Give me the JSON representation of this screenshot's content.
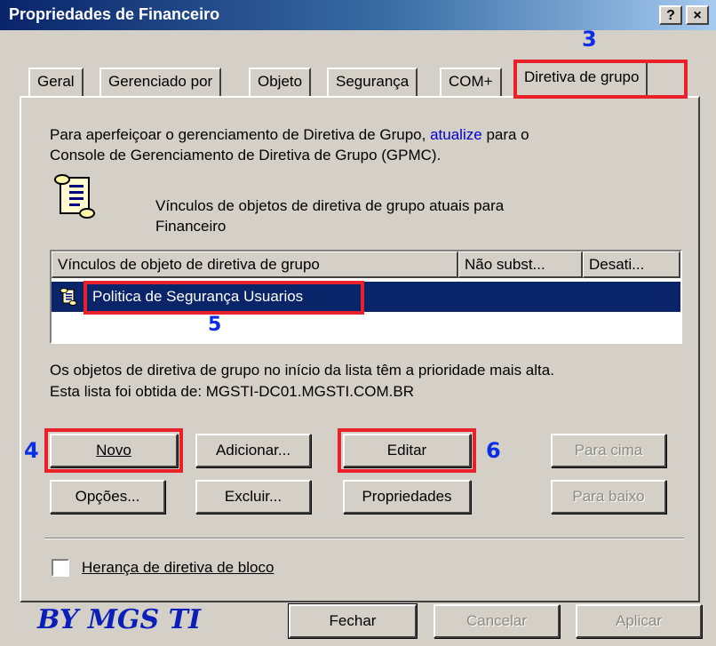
{
  "window": {
    "title": "Propriedades de Financeiro",
    "help_button": "?",
    "close_button": "×"
  },
  "tabs": [
    {
      "label": "Geral"
    },
    {
      "label": "Gerenciado por"
    },
    {
      "label": "Objeto"
    },
    {
      "label": "Segurança"
    },
    {
      "label": "COM+"
    },
    {
      "label": "Diretiva de grupo"
    }
  ],
  "info": {
    "line1_prefix": "Para aperfeiçoar o gerenciamento de Diretiva de Grupo,",
    "link": "atualize",
    "line1_suffix": "para o",
    "line2": "Console de Gerenciamento de Diretiva de Grupo (GPMC)."
  },
  "current_links": {
    "line1": "Vínculos de objetos de diretiva de grupo atuais para",
    "line2": "Financeiro",
    "icon": "scroll-icon"
  },
  "list": {
    "columns": [
      "Vínculos de objeto de diretiva de grupo",
      "Não subst...",
      "Desati..."
    ],
    "rows": [
      {
        "name": "Politica de Segurança Usuarios",
        "icon": "gpo-scroll-icon"
      }
    ]
  },
  "priority_note": {
    "line1": "Os objetos de diretiva de grupo no início da lista têm a prioridade mais alta.",
    "line2": "Esta lista foi obtida de: MGSTI-DC01.MGSTI.COM.BR"
  },
  "buttons": {
    "novo": "Novo",
    "adicionar": "Adicionar...",
    "editar": "Editar",
    "para_cima": "Para cima",
    "opcoes": "Opções...",
    "excluir": "Excluir...",
    "propriedades": "Propriedades",
    "para_baixo": "Para baixo"
  },
  "checkbox": {
    "label": "Herança de diretiva de bloco",
    "checked": false
  },
  "footer": {
    "watermark": "BY MGS TI",
    "fechar": "Fechar",
    "cancelar": "Cancelar",
    "aplicar": "Aplicar"
  },
  "annotations": {
    "step3": "3",
    "step4": "4",
    "step5": "5",
    "step6": "6",
    "highlight_color": "#e8212a",
    "number_color": "#0a2ee6"
  }
}
